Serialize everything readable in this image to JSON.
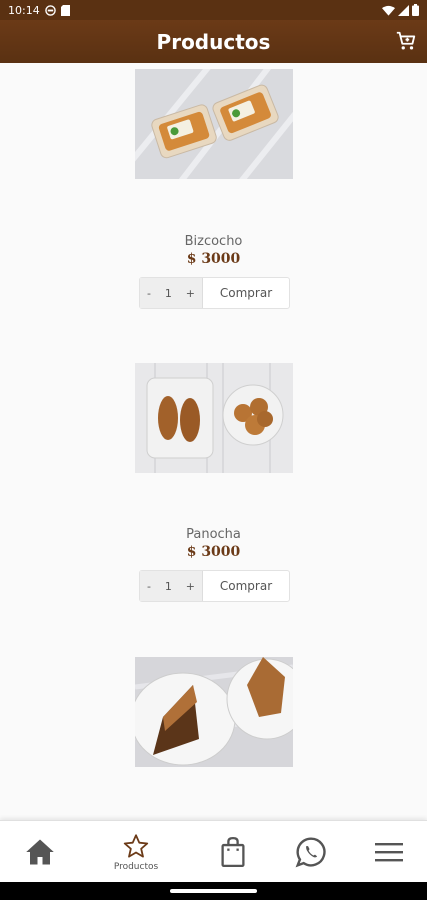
{
  "status": {
    "time": "10:14"
  },
  "header": {
    "title": "Productos"
  },
  "products": [
    {
      "name": "Bizcocho",
      "price": "$ 3000",
      "qty_minus": "-",
      "qty": "1",
      "qty_plus": "+",
      "buy_label": "Comprar"
    },
    {
      "name": "Panocha",
      "price": "$ 3000",
      "qty_minus": "-",
      "qty": "1",
      "qty_plus": "+",
      "buy_label": "Comprar"
    }
  ],
  "nav": {
    "products_label": "Productos"
  },
  "colors": {
    "brand": "#5a3112",
    "accent": "#6b3a17"
  }
}
